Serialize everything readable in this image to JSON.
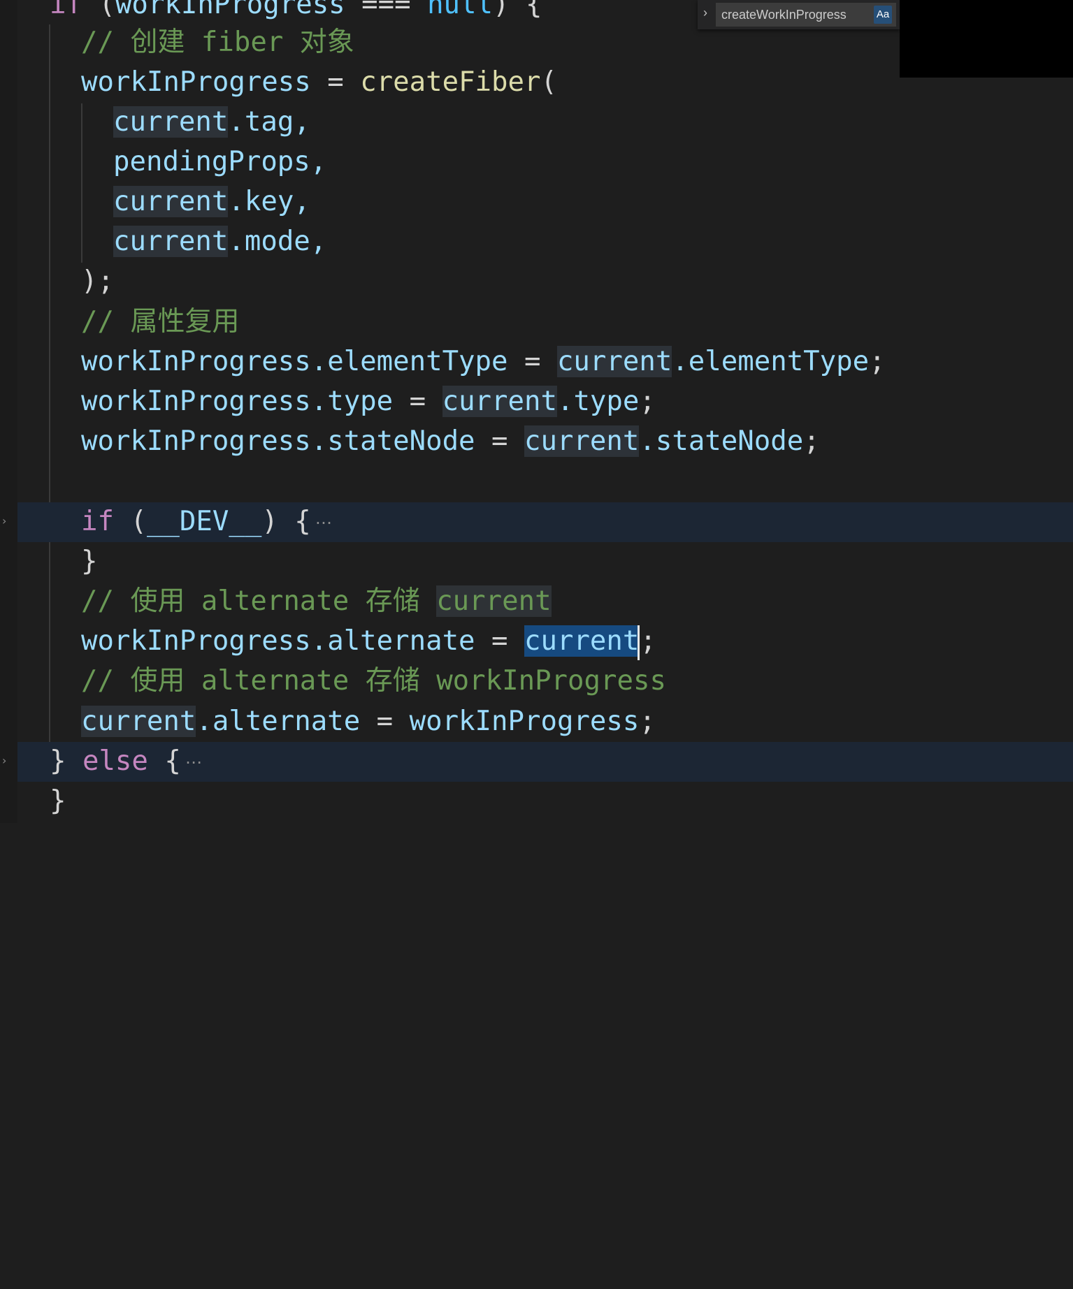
{
  "find_widget": {
    "toggle_icon": "chevron-right-icon",
    "value": "createWorkInProgress",
    "match_case_label": "Aa"
  },
  "editor": {
    "lines": {
      "l0": [
        "if",
        " (",
        "workInProgress",
        " === ",
        "null",
        ") {"
      ],
      "l1": "// 创建 fiber 对象",
      "l2": [
        "workInProgress",
        " = ",
        "createFiber",
        "("
      ],
      "l3": [
        "current",
        ".tag,"
      ],
      "l4": "pendingProps,",
      "l5": [
        "current",
        ".key,"
      ],
      "l6": [
        "current",
        ".mode,"
      ],
      "l7": ");",
      "l8": "// 属性复用",
      "l9": [
        "workInProgress",
        ".elementType",
        " = ",
        "current",
        ".elementType",
        ";"
      ],
      "l10": [
        "workInProgress",
        ".type",
        " = ",
        "current",
        ".type",
        ";"
      ],
      "l11": [
        "workInProgress",
        ".stateNode",
        " = ",
        "current",
        ".stateNode",
        ";"
      ],
      "l13": [
        "if",
        " (",
        "__DEV__",
        ") {",
        "⋯"
      ],
      "l14": "}",
      "l15": [
        "// 使用 alternate 存储 ",
        "current"
      ],
      "l16": [
        "workInProgress",
        ".alternate",
        " = ",
        "current",
        ";"
      ],
      "l17": "// 使用 alternate 存储 workInProgress",
      "l18": [
        "current",
        ".alternate",
        " = ",
        "workInProgress",
        ";"
      ],
      "l19": [
        "} ",
        "else",
        " {",
        "⋯"
      ],
      "l20": "}"
    }
  },
  "colors": {
    "background": "#1e1e1e",
    "keyword": "#c586c0",
    "variable": "#9cdcfe",
    "function": "#dcdcaa",
    "comment": "#6a9955",
    "selection": "#164a80",
    "occurrence_highlight": "#2d3238",
    "folded_line": "#1c2634"
  }
}
